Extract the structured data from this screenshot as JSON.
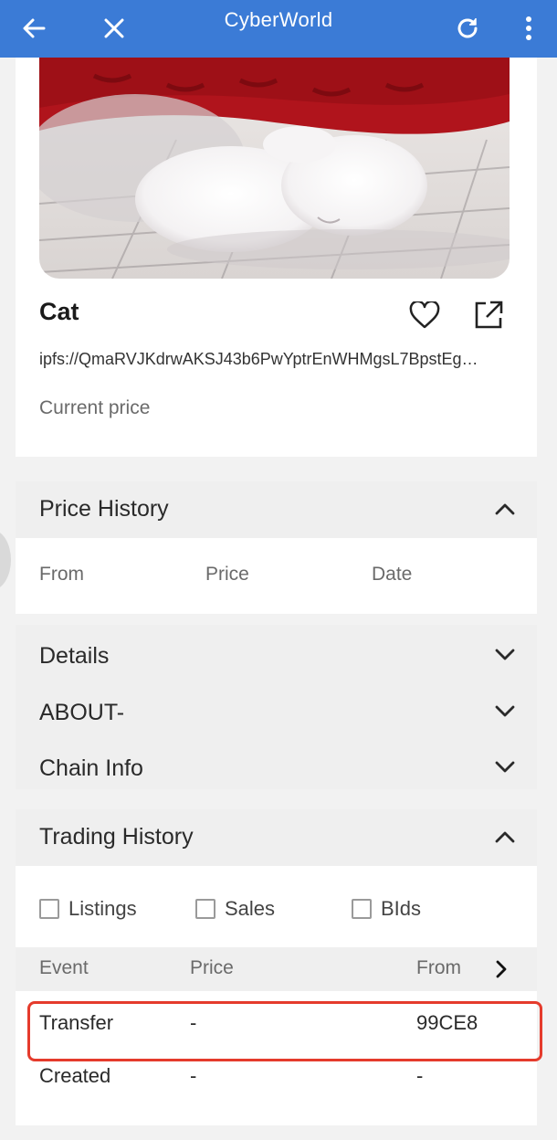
{
  "app": {
    "title": "CyberWorld"
  },
  "colors": {
    "topbar": "#3b7bd6",
    "highlight": "#e53b2c"
  },
  "icons": {
    "back": "arrow-left-icon",
    "close": "close-icon",
    "reload": "refresh-icon",
    "menu": "more-vertical-icon",
    "favorite": "heart-icon",
    "share": "open-external-icon"
  },
  "nft": {
    "title": "Cat",
    "ipfs": "ipfs://QmaRVJKdrwAKSJ43b6PwYptrEnWHMgsL7BpstEg…",
    "current_price_label": "Current price"
  },
  "price_history": {
    "label": "Price History",
    "columns": [
      "From",
      "Price",
      "Date"
    ]
  },
  "collapsed_sections": [
    {
      "label": "Details"
    },
    {
      "label": "ABOUT-"
    },
    {
      "label": "Chain Info"
    }
  ],
  "trading_history": {
    "label": "Trading History",
    "filters": [
      {
        "label": "Listings",
        "checked": false
      },
      {
        "label": "Sales",
        "checked": false
      },
      {
        "label": "BIds",
        "checked": false
      }
    ],
    "columns": [
      "Event",
      "Price",
      "From"
    ],
    "rows": [
      {
        "event": "Transfer",
        "price": "-",
        "from": "99CE8",
        "highlighted": true
      },
      {
        "event": "Created",
        "price": "-",
        "from": "-",
        "highlighted": false
      }
    ]
  }
}
